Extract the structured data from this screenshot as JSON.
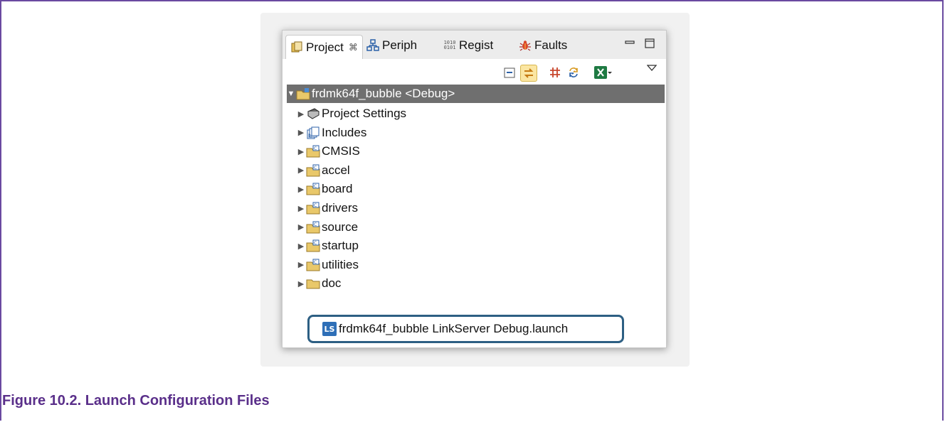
{
  "panel": {
    "tabs": [
      {
        "label": "Project",
        "icon": "project-explorer-icon",
        "active": true,
        "close_glyph": "⌘"
      },
      {
        "label": "Periph",
        "icon": "peripherals-icon",
        "active": false
      },
      {
        "label": "Regist",
        "icon": "registers-icon",
        "active": false
      },
      {
        "label": "Faults",
        "icon": "faults-bug-icon",
        "active": false
      }
    ],
    "toolbar_icons": [
      "collapse-all-icon",
      "link-with-editor-icon",
      "grid-icon",
      "refresh-icon",
      "excel-icon",
      "dropdown-icon",
      "view-menu-icon"
    ]
  },
  "tree": {
    "root": {
      "label": "frdmk64f_bubble <Debug>",
      "expanded": true
    },
    "items": [
      {
        "label": "Project Settings",
        "icon": "settings-book-icon"
      },
      {
        "label": "Includes",
        "icon": "includes-icon"
      },
      {
        "label": "CMSIS",
        "icon": "source-folder-icon"
      },
      {
        "label": "accel",
        "icon": "source-folder-icon"
      },
      {
        "label": "board",
        "icon": "source-folder-icon"
      },
      {
        "label": "drivers",
        "icon": "source-folder-icon"
      },
      {
        "label": "source",
        "icon": "source-folder-icon"
      },
      {
        "label": "startup",
        "icon": "source-folder-icon"
      },
      {
        "label": "utilities",
        "icon": "source-folder-icon"
      },
      {
        "label": "doc",
        "icon": "folder-icon"
      }
    ],
    "launch_file": {
      "label": "frdmk64f_bubble LinkServer Debug.launch",
      "icon_text": "LS"
    }
  },
  "caption": "Figure 10.2. Launch Configuration Files",
  "colors": {
    "caption": "#5a2f8a",
    "highlight": "#2d5f83",
    "root_bg": "#6f6f6f",
    "frame": "#6a4aa0"
  }
}
